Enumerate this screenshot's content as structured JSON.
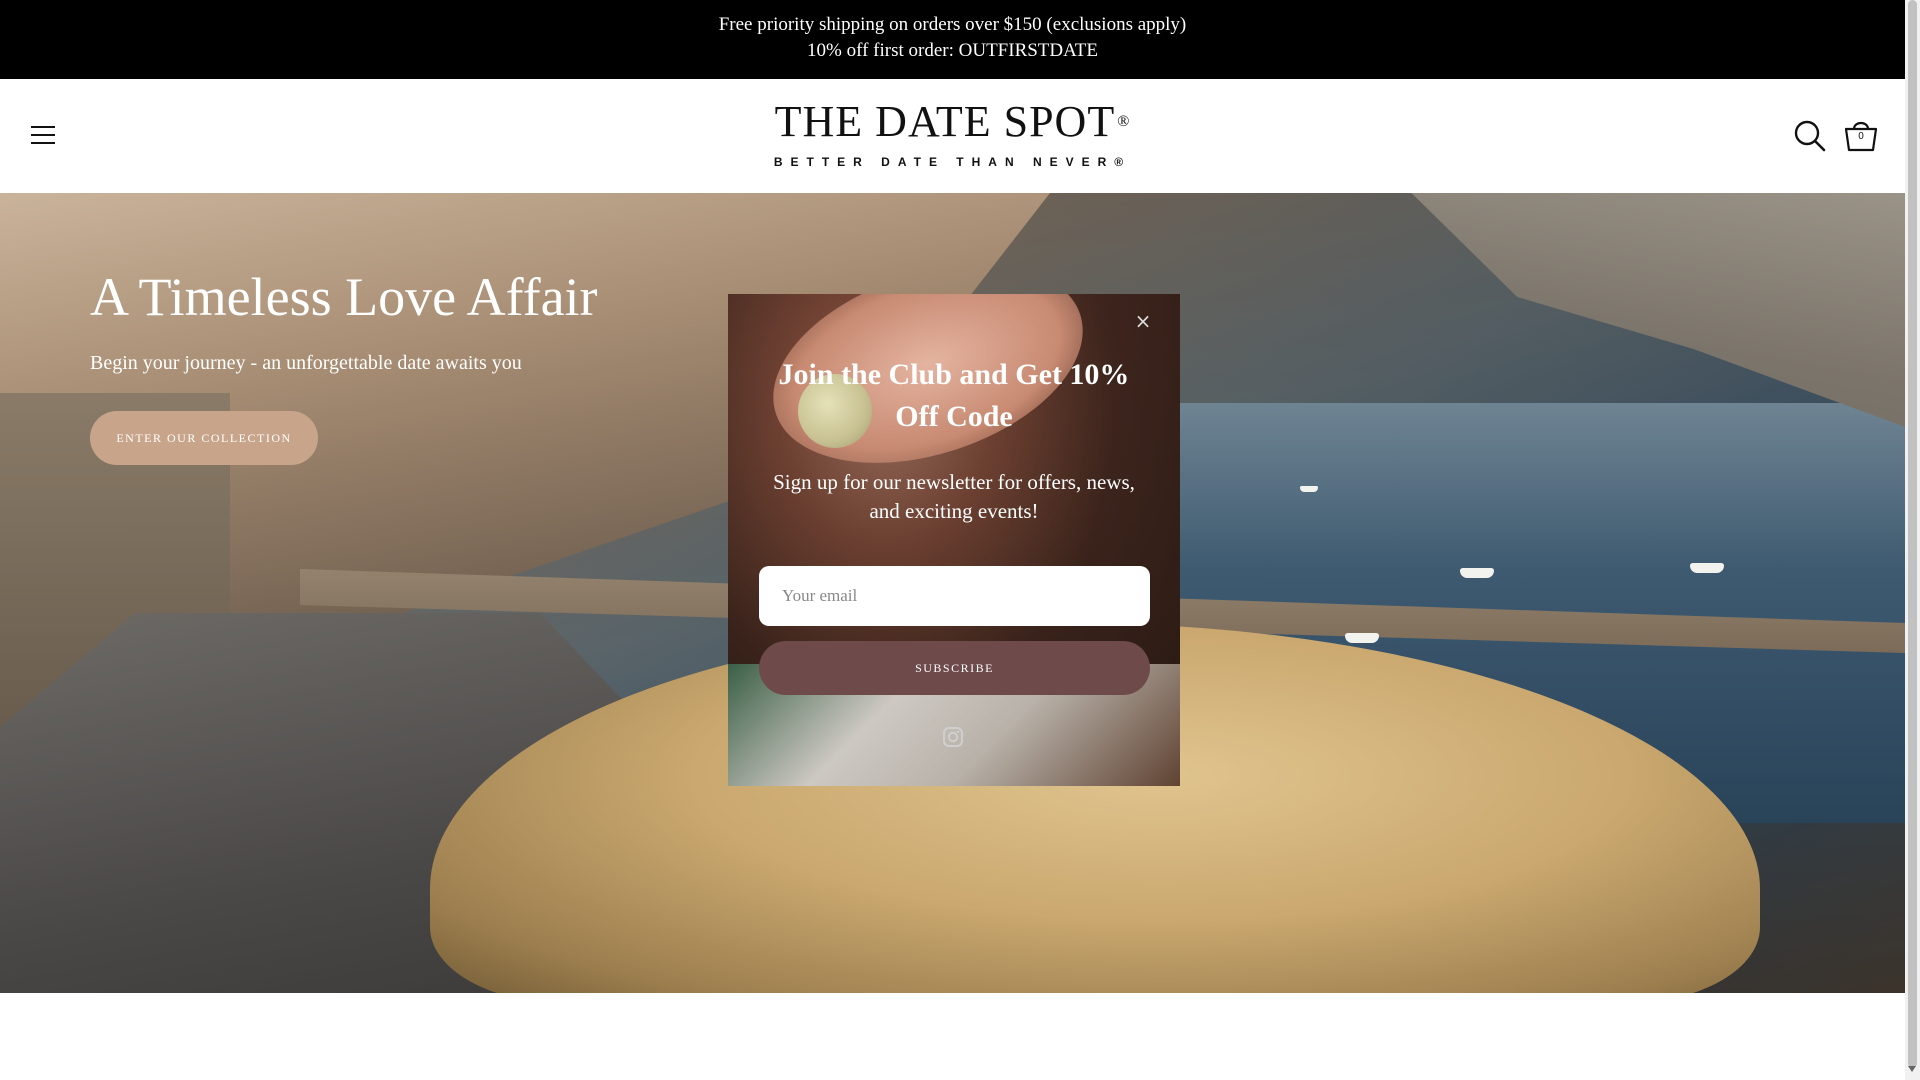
{
  "announcement": {
    "line1": "Free priority shipping on orders over $150 (exclusions apply)",
    "line2": "10% off first order: OUTFIRSTDATE"
  },
  "header": {
    "logo_main": "THE DATE SPOT",
    "logo_reg": "®",
    "logo_tagline": "BETTER DATE THAN NEVER®",
    "menu_icon": "hamburger-menu-icon",
    "search_icon": "search-icon",
    "cart_icon": "cart-icon",
    "cart_count": "0"
  },
  "hero": {
    "title": "A Timeless Love Affair",
    "subtitle": "Begin your journey - an unforgettable date awaits you",
    "cta_label": "ENTER OUR COLLECTION"
  },
  "popup": {
    "close_label": "×",
    "title": "Join the Club and Get 10% Off Code",
    "text": "Sign up for our newsletter for offers, news, and exciting events!",
    "email_placeholder": "Your email",
    "email_value": "",
    "submit_label": "SUBSCRIBE",
    "social_icon": "instagram-icon"
  },
  "colors": {
    "announcement_bg": "#000000",
    "cta_bg": "#c8a58a",
    "submit_bg": "#6e4a4a"
  }
}
